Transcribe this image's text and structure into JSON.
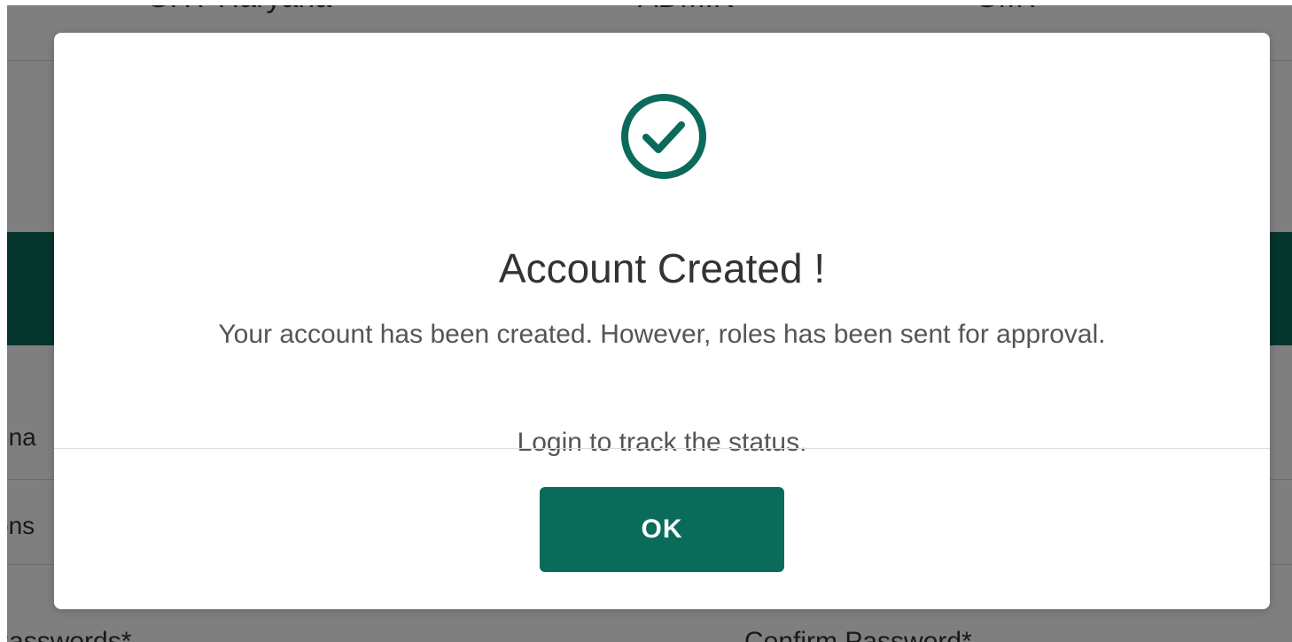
{
  "background": {
    "top_row": [
      "GHT Haryana",
      "ADMIN",
      "GMT"
    ],
    "field_labels": [
      "gna",
      "ons"
    ],
    "bottom_labels": [
      "Passwords*",
      "Confirm Password*"
    ],
    "accent_color": "#0b6b5a"
  },
  "modal": {
    "icon": "check-circle-icon",
    "title": "Account Created !",
    "message": "Your account has been created. However, roles has been sent for approval.",
    "sub_message": "Login to track the status.",
    "ok_label": "OK",
    "accent_color": "#0b6b5a"
  }
}
